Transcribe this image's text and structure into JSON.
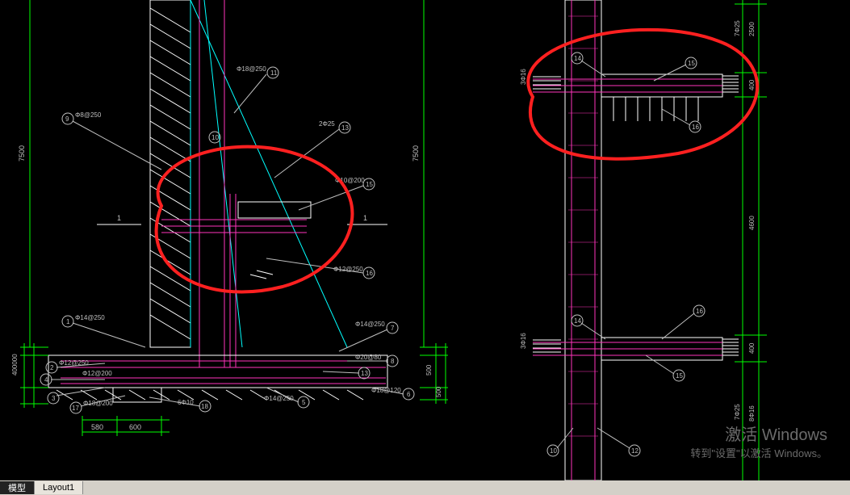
{
  "tabs": {
    "model": "模型",
    "layout1": "Layout1"
  },
  "watermark": {
    "line1": "激活 Windows",
    "line2": "转到\"设置\"以激活 Windows。"
  },
  "dims": {
    "h7500": "7500",
    "h7500b": "7500",
    "h400000": "400000",
    "h500": "500",
    "h500b": "500",
    "w580": "580",
    "w600": "600",
    "h4600": "4600",
    "h400a": "400",
    "h400b": "400",
    "v2500": "2500",
    "v7d25": "7Φ25",
    "v3d16a": "3Φ16",
    "v3d16b": "3Φ16",
    "v7d25b": "7Φ25",
    "v8d16": "8Φ16"
  },
  "callouts": {
    "c1": {
      "txt": "Φ14@250",
      "num": "1"
    },
    "c2": {
      "txt": "Φ12@250",
      "num": "2"
    },
    "c3": {
      "txt": "",
      "num": "3"
    },
    "c4": {
      "txt": "",
      "num": "4"
    },
    "c5": {
      "txt": "Φ14@250",
      "num": "5"
    },
    "c6": {
      "txt": "Φ18@120",
      "num": "6"
    },
    "c7": {
      "txt": "Φ14@250",
      "num": "7"
    },
    "c8": {
      "txt": "Φ20@80",
      "num": "8"
    },
    "c9": {
      "txt": "Φ8@250",
      "num": "9"
    },
    "c10": {
      "txt": "",
      "num": "10"
    },
    "c11": {
      "txt": "Φ18@250",
      "num": "11"
    },
    "c13": {
      "txt": "2Φ25",
      "num": "13"
    },
    "c13b": {
      "txt": "",
      "num": "13"
    },
    "c14": {
      "txt": "",
      "num": "14"
    },
    "c14b": {
      "txt": "",
      "num": "14"
    },
    "c15": {
      "txt": "Φ10@200",
      "num": "15"
    },
    "c15b": {
      "txt": "",
      "num": "15"
    },
    "c15c": {
      "txt": "",
      "num": "15"
    },
    "c16": {
      "txt": "Φ12@250",
      "num": "16"
    },
    "c16b": {
      "txt": "",
      "num": "16"
    },
    "c16c": {
      "txt": "",
      "num": "16"
    },
    "c17": {
      "txt": "Φ18@200",
      "num": "17"
    },
    "c18": {
      "txt": "6Φ10",
      "num": "18"
    },
    "c19": {
      "txt": "Φ12@200",
      "num": ""
    },
    "cR10": {
      "txt": "",
      "num": "10"
    },
    "cR12": {
      "txt": "",
      "num": "12"
    }
  },
  "sections": {
    "one_l": "1",
    "one_r": "1"
  }
}
